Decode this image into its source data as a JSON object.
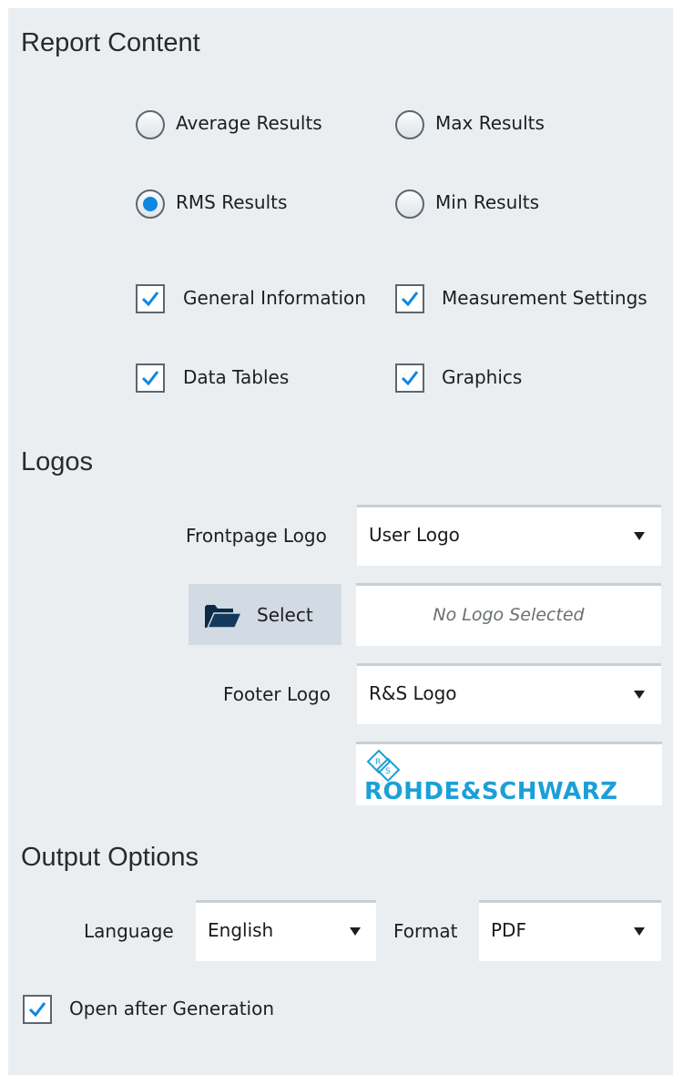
{
  "report_content": {
    "title": "Report Content",
    "radios": {
      "average": {
        "label": "Average Results",
        "selected": false
      },
      "max": {
        "label": "Max Results",
        "selected": false
      },
      "rms": {
        "label": "RMS Results",
        "selected": true
      },
      "min": {
        "label": "Min Results",
        "selected": false
      }
    },
    "checkboxes": {
      "general": {
        "label": "General Information",
        "checked": true
      },
      "measurement": {
        "label": "Measurement Settings",
        "checked": true
      },
      "tables": {
        "label": "Data Tables",
        "checked": true
      },
      "graphics": {
        "label": "Graphics",
        "checked": true
      }
    }
  },
  "logos": {
    "title": "Logos",
    "frontpage_label": "Frontpage Logo",
    "frontpage_value": "User Logo",
    "select_button": "Select",
    "select_placeholder": "No Logo Selected",
    "footer_label": "Footer Logo",
    "footer_value": "R&S Logo",
    "footer_preview_text": "ROHDE&SCHWARZ"
  },
  "output_options": {
    "title": "Output Options",
    "language_label": "Language",
    "language_value": "English",
    "format_label": "Format",
    "format_value": "PDF",
    "open_after": {
      "label": "Open after Generation",
      "checked": true
    }
  },
  "colors": {
    "panel_bg": "#ebeef1",
    "accent": "#0e87e0",
    "logo_blue": "#1aa0d8",
    "button_bg": "#d2dbe4"
  },
  "icons": [
    "radio",
    "checkbox-check-icon",
    "dropdown-arrow-icon",
    "folder-open-icon",
    "rohde-schwarz-logo-icon"
  ]
}
